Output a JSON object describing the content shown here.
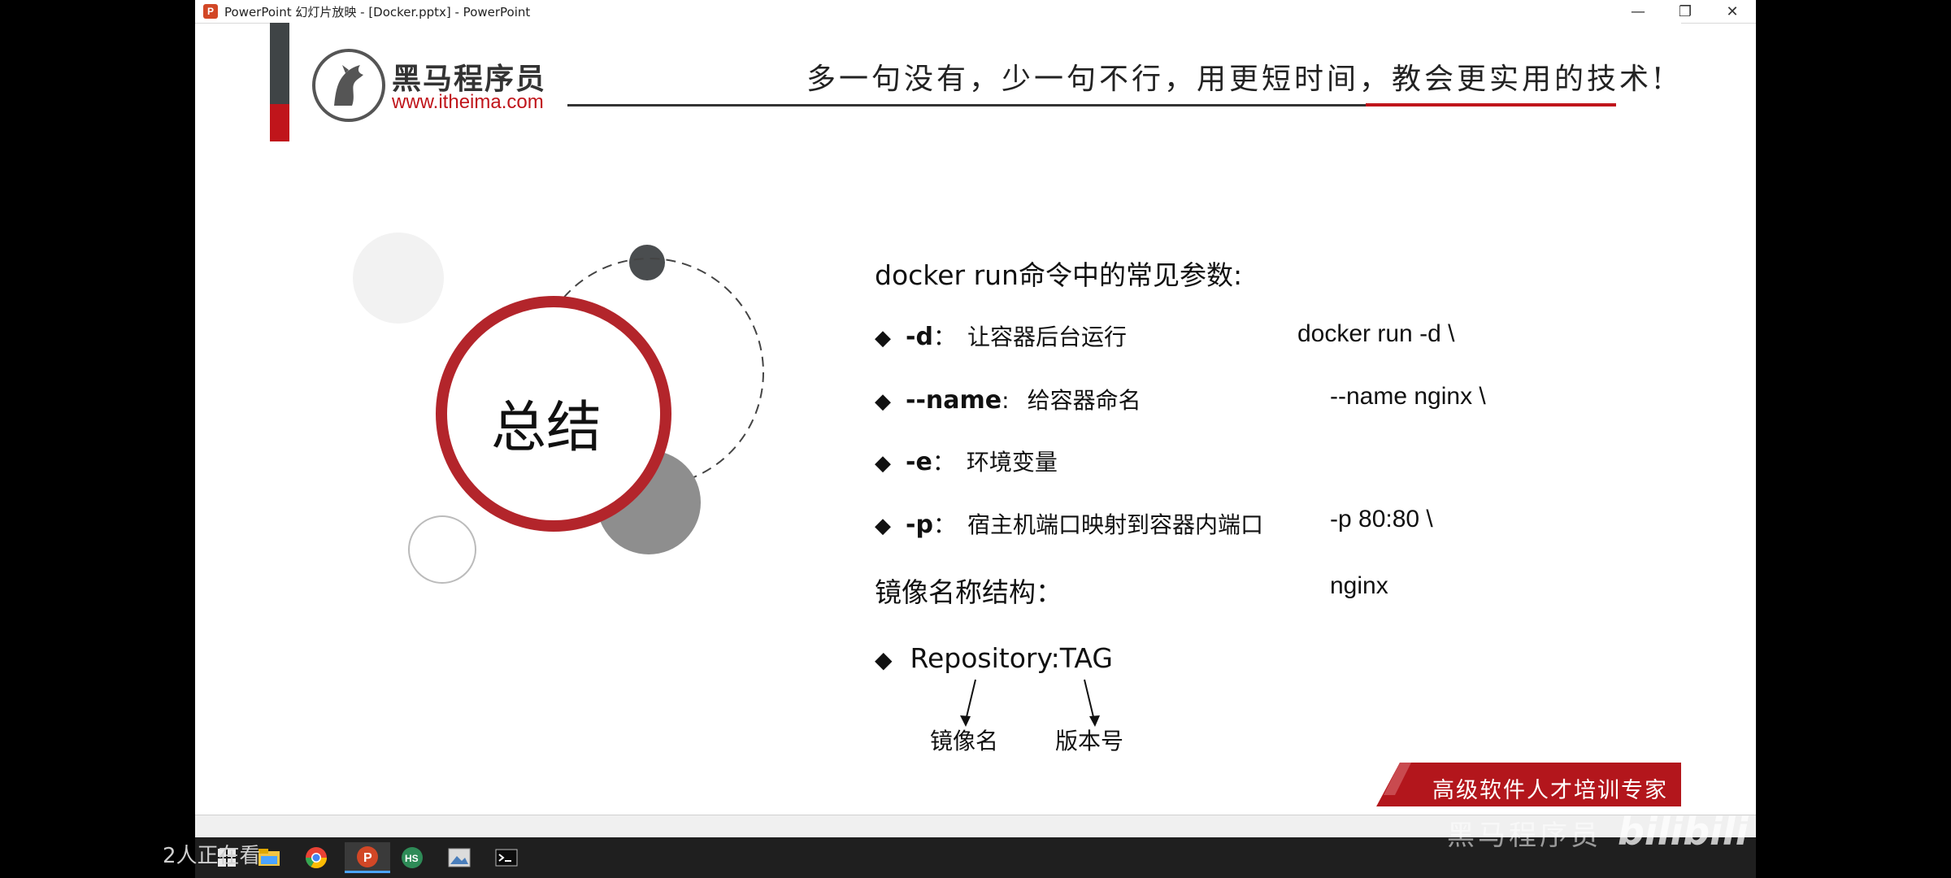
{
  "window": {
    "title": "PowerPoint 幻灯片放映 - [Docker.pptx] - PowerPoint",
    "app_icon": "P",
    "controls": [
      "—",
      "❐",
      "✕"
    ]
  },
  "header": {
    "logo_name": "黑马程序员",
    "logo_url": "www.itheima.com",
    "slogan": "多一句没有，少一句不行，用更短时间，教会更实用的技术!"
  },
  "summary": {
    "title": "总结"
  },
  "content": {
    "heading": "docker run命令中的常见参数:",
    "params": [
      {
        "flag": "-d",
        "sep": "：",
        "desc": "让容器后台运行"
      },
      {
        "flag": "--name",
        "sep": ":",
        "desc": "给容器命名"
      },
      {
        "flag": "-e",
        "sep": "：",
        "desc": "环境变量"
      },
      {
        "flag": "-p",
        "sep": "：",
        "desc": "宿主机端口映射到容器内端口"
      }
    ],
    "command": [
      "docker run -d \\",
      "--name nginx \\",
      "-p 80:80 \\",
      "nginx"
    ],
    "image_heading": "镜像名称结构：",
    "repo": "Repository:TAG",
    "repo_label": "镜像名",
    "tag_label": "版本号",
    "bullet": "◆"
  },
  "footer": {
    "banner": "高级软件人才培训专家"
  },
  "overlay": {
    "viewers": "2人正在看",
    "watermark": "黑马程序员",
    "site_logo": "bilibili"
  },
  "colors": {
    "brand_red": "#c0151b",
    "dark": "#3f4446"
  }
}
